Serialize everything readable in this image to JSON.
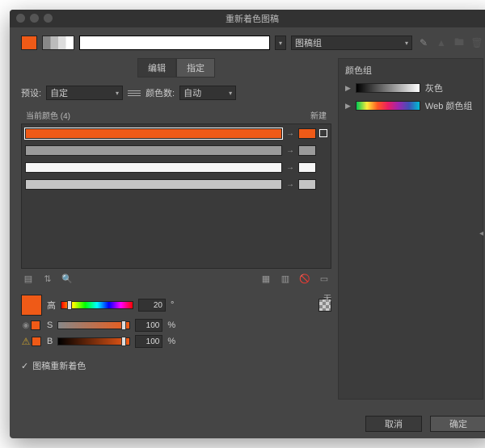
{
  "window": {
    "title": "重新着色图稿"
  },
  "top": {
    "groupSelectLabel": "图稿组",
    "colorCountLabel": "颜色数:",
    "colorCountValue": "自动"
  },
  "tabs": {
    "edit": "编辑",
    "assign": "指定"
  },
  "preset": {
    "label": "预设:",
    "value": "自定"
  },
  "currentColors": {
    "headerLeft": "当前颜色 (4)",
    "headerRight": "新建",
    "rows": [
      {
        "bar": "#ef5a17",
        "swatch": "#ef5a17",
        "selected": true
      },
      {
        "bar": "#9a9a9a",
        "swatch": "#9a9a9a",
        "selected": false
      },
      {
        "bar": "#f6f6f6",
        "swatch": "#f6f6f6",
        "selected": false
      },
      {
        "bar": "#c4c4c4",
        "swatch": "#c4c4c4",
        "selected": false
      }
    ]
  },
  "hsb": {
    "hLabel": "高",
    "hValue": "20",
    "hUnit": "°",
    "sLabel": "S",
    "sValue": "100",
    "sUnit": "%",
    "bLabel": "B",
    "bValue": "100",
    "bUnit": "%",
    "noneLabel": "无"
  },
  "checkbox": {
    "label": "图稿重新着色"
  },
  "rightPanel": {
    "header": "颜色组",
    "items": [
      {
        "label": "灰色",
        "gradient": "linear-gradient(to right,#000,#fff)"
      },
      {
        "label": "Web 颜色组",
        "gradient": "linear-gradient(to right,#00c853,#ffeb3b,#ff5722,#e91e63,#9c27b0,#3f51b5,#00bcd4)"
      }
    ]
  },
  "footer": {
    "cancel": "取消",
    "ok": "确定"
  }
}
